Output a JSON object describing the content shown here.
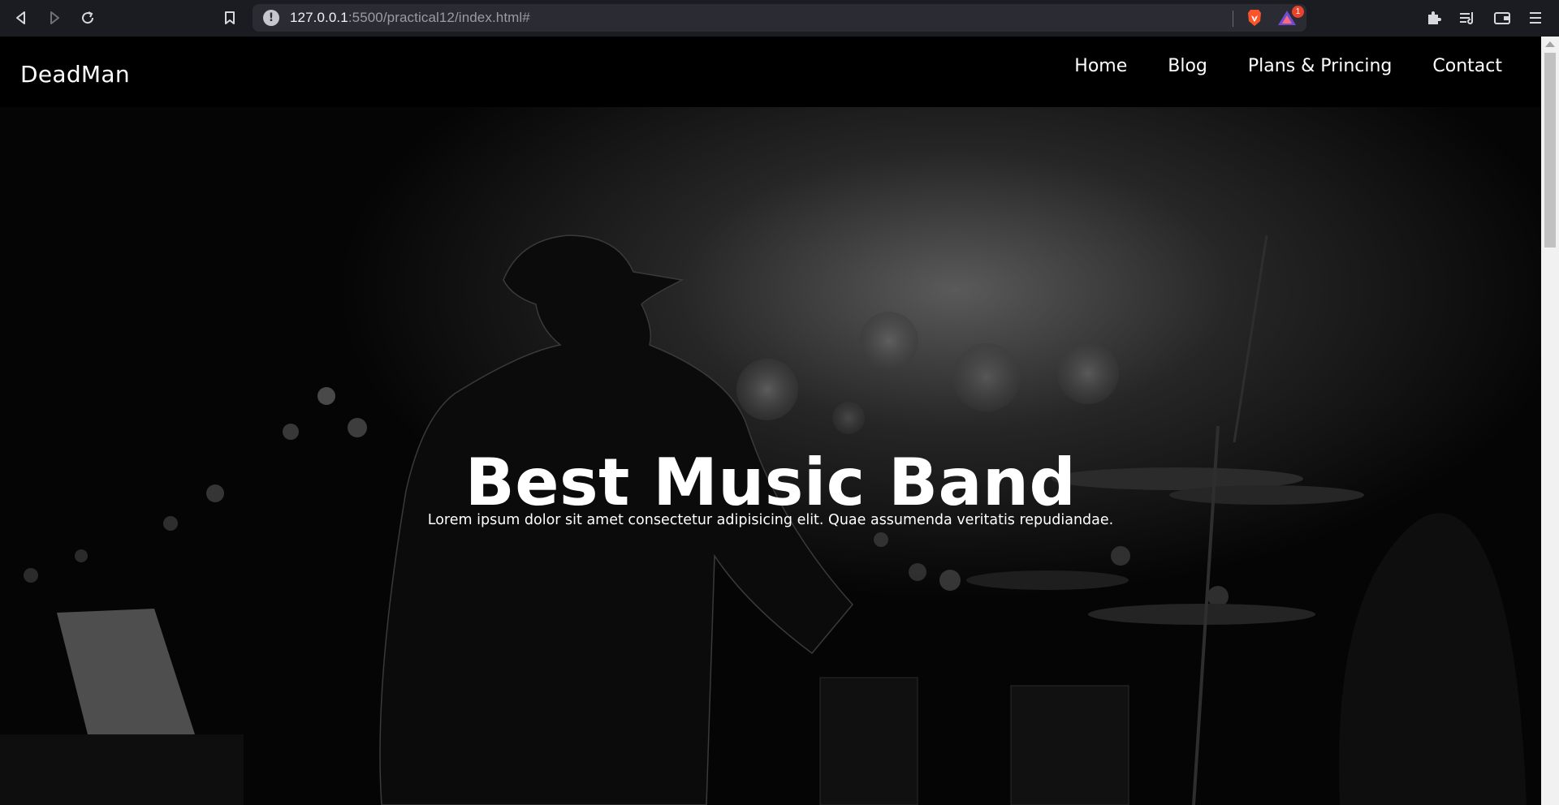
{
  "browser": {
    "url_host": "127.0.0.1",
    "url_path": ":5500/practical12/index.html#",
    "rewards_badge": "1"
  },
  "site": {
    "logo": "DeadMan",
    "nav": [
      {
        "label": "Home"
      },
      {
        "label": "Blog"
      },
      {
        "label": "Plans & Princing"
      },
      {
        "label": "Contact"
      }
    ]
  },
  "hero": {
    "title": "Best Music Band",
    "subtitle": "Lorem ipsum dolor sit amet consectetur adipisicing elit. Quae assumenda veritatis repudiandae.",
    "image": "black-and-white concert photo of a drummer on stage"
  },
  "colors": {
    "chrome_bg": "#1b1c22",
    "urlbar_bg": "#2b2c33",
    "header_bg": "#000000",
    "text": "#ffffff"
  }
}
